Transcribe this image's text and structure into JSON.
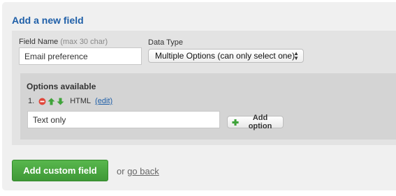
{
  "heading": "Add a new field",
  "field_name": {
    "label": "Field Name",
    "hint": "(max 30 char)",
    "value": "Email preference"
  },
  "data_type": {
    "label": "Data Type",
    "selected": "Multiple Options (can only select one)"
  },
  "options": {
    "title": "Options available",
    "items": [
      {
        "number": "1.",
        "name": "HTML",
        "edit_label": "(edit)"
      }
    ],
    "new_option_value": "Text only",
    "add_option_label": "Add option"
  },
  "actions": {
    "submit_label": "Add custom field",
    "or_text": "or",
    "go_back_label": "go back"
  },
  "colors": {
    "heading": "#1f5fa8",
    "primary_button": "#4aa741",
    "remove_icon": "#e0463a",
    "arrow_icons": "#3fa33a"
  }
}
